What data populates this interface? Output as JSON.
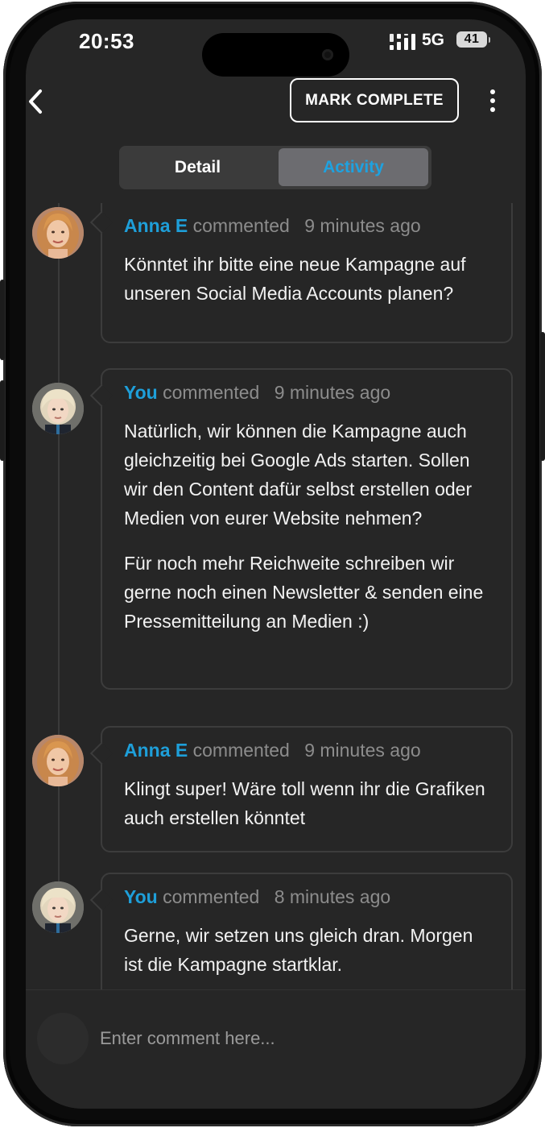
{
  "status_bar": {
    "time": "20:53",
    "network": "5G",
    "battery": "41"
  },
  "header": {
    "mark_complete_label": "MARK COMPLETE"
  },
  "tabs": [
    {
      "label": "Detail",
      "active": false
    },
    {
      "label": "Activity",
      "active": true
    }
  ],
  "colors": {
    "accent": "#1e9fd9",
    "background": "#262626",
    "card_border": "#3c3c3c"
  },
  "activity": [
    {
      "author": "Anna E",
      "action": "commented",
      "time": "9 minutes ago",
      "paragraphs": [
        "Könntet ihr bitte eine neue Kampagne auf unseren Social Media Accounts planen?"
      ]
    },
    {
      "author": "You",
      "action": "commented",
      "time": "9 minutes ago",
      "paragraphs": [
        "Natürlich, wir können die Kampagne auch gleichzeitig bei Google Ads starten. Sollen wir den Content dafür selbst erstellen oder Medien von eurer Website nehmen?",
        "Für noch mehr Reichweite schreiben wir gerne noch einen Newsletter & senden eine Pressemitteilung an Medien :)"
      ]
    },
    {
      "author": "Anna E",
      "action": "commented",
      "time": "9 minutes ago",
      "paragraphs": [
        "Klingt super! Wäre toll wenn ihr die Grafiken auch erstellen könntet"
      ]
    },
    {
      "author": "You",
      "action": "commented",
      "time": "8 minutes ago",
      "paragraphs": [
        "Gerne, wir setzen uns gleich dran. Morgen ist die Kampagne startklar."
      ]
    }
  ],
  "comment_box": {
    "placeholder": "Enter comment here..."
  }
}
